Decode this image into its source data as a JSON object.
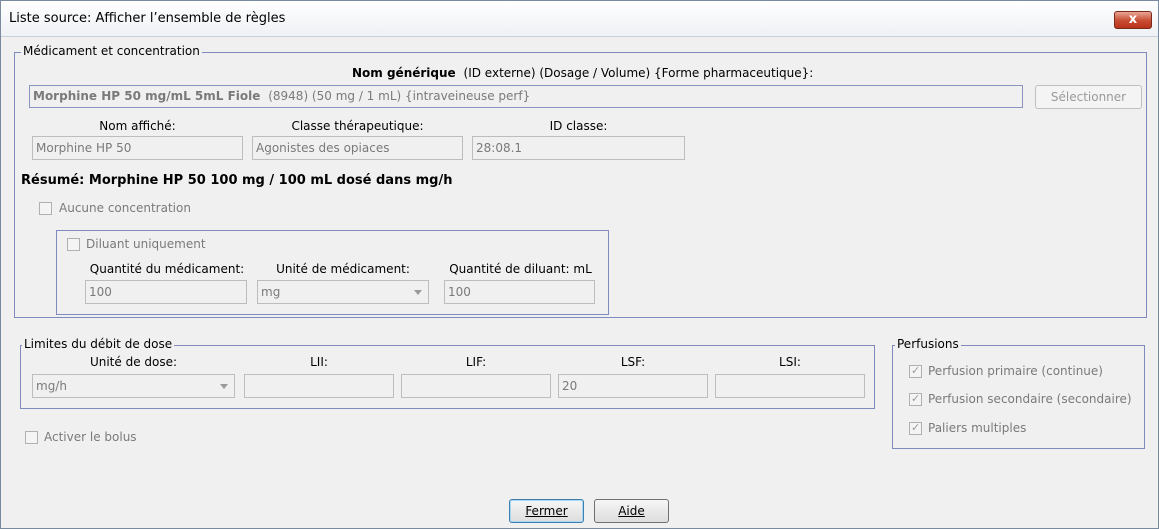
{
  "window": {
    "title": "Liste source: Afficher l’ensemble de règles",
    "close_label": "x"
  },
  "medication": {
    "legend": "Médicament et concentration",
    "generic_header_bold": "Nom générique",
    "generic_header_rest": "(ID externe) (Dosage / Volume) {Forme pharmaceutique}:",
    "generic_value_bold": "Morphine HP 50 mg/mL 5mL Fiole",
    "generic_value_rest": "(8948) (50 mg / 1 mL) {intraveineuse perf}",
    "select_button": "Sélectionner",
    "display_name_label": "Nom affiché:",
    "display_name_value": "Morphine HP  50",
    "therapeutic_class_label": "Classe thérapeutique:",
    "therapeutic_class_value": "Agonistes des opiaces",
    "class_id_label": "ID classe:",
    "class_id_value": "28:08.1",
    "summary": "Résumé: Morphine HP  50 100 mg / 100 mL dosé dans mg/h",
    "no_concentration_label": "Aucune concentration",
    "diluent_only_label": "Diluant uniquement",
    "drug_amount_label": "Quantité du médicament:",
    "drug_amount_value": "100",
    "drug_unit_label": "Unité de médicament:",
    "drug_unit_value": "mg",
    "diluent_amount_label": "Quantité de diluant: mL",
    "diluent_amount_value": "100"
  },
  "dose_limits": {
    "legend": "Limites du débit de dose",
    "dose_unit_label": "Unité de dose:",
    "dose_unit_value": "mg/h",
    "lii_label": "LII:",
    "lii_value": "",
    "lif_label": "LIF:",
    "lif_value": "",
    "lsf_label": "LSF:",
    "lsf_value": "20",
    "lsi_label": "LSI:",
    "lsi_value": ""
  },
  "infusions": {
    "legend": "Perfusions",
    "primary_label": "Perfusion primaire (continue)",
    "secondary_label": "Perfusion secondaire (secondaire)",
    "multistep_label": "Paliers multiples"
  },
  "bolus": {
    "label": "Activer le bolus"
  },
  "footer": {
    "close_button": "Fermer",
    "help_button": "Aide"
  }
}
